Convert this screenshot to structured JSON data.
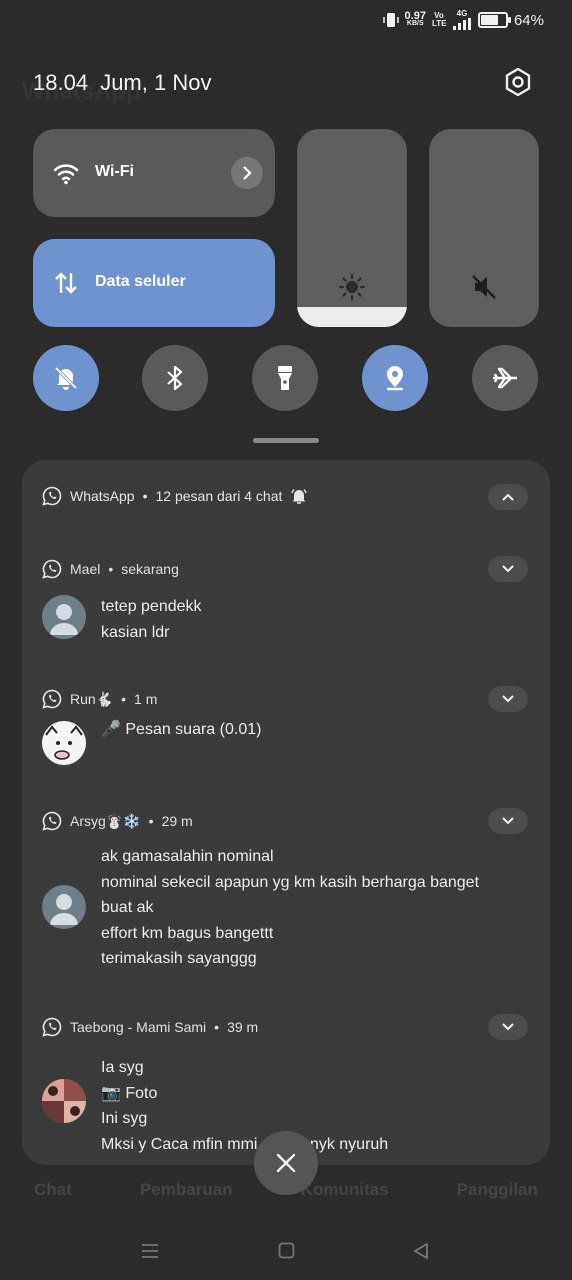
{
  "status_bar": {
    "speed": "0.97",
    "speed_unit": "KB/S",
    "volte": "Vo LTE",
    "network": "4G",
    "battery_percent": "64%",
    "battery_level": 0.64
  },
  "header": {
    "time": "18.04",
    "date": "Jum, 1 Nov",
    "background_title": "WhatsApp"
  },
  "quick_settings": {
    "wifi_label": "Wi-Fi",
    "data_label": "Data seluler",
    "brightness_level": 0.1,
    "toggles": [
      {
        "name": "dnd",
        "icon": "bell-off-icon",
        "on": true
      },
      {
        "name": "bluetooth",
        "icon": "bluetooth-icon",
        "on": false
      },
      {
        "name": "flashlight",
        "icon": "flashlight-icon",
        "on": false
      },
      {
        "name": "location",
        "icon": "location-icon",
        "on": true
      },
      {
        "name": "airplane",
        "icon": "airplane-icon",
        "on": false
      }
    ]
  },
  "notifications": {
    "group": {
      "app": "WhatsApp",
      "summary": "12 pesan dari 4 chat"
    },
    "items": [
      {
        "sender": "Mael",
        "time": "sekarang",
        "messages": [
          "tetep pendekk",
          "kasian ldr"
        ]
      },
      {
        "sender": "Run🐇",
        "time": "1 m",
        "messages": [
          "🎤 Pesan suara (0.01)"
        ]
      },
      {
        "sender": "Arsyg☃️❄️",
        "time": "29 m",
        "messages": [
          "ak gamasalahin nominal",
          "nominal sekecil apapun yg km kasih berharga banget",
          "buat ak",
          "effort km bagus bangettt",
          "terimakasih sayanggg"
        ]
      },
      {
        "sender": "Taebong - Mami Sami",
        "time": "39 m",
        "messages": [
          "Ia syg",
          "📷 Foto",
          "Ini syg",
          "Mksi y Caca mfin mmi sring bnyk nyuruh"
        ]
      }
    ]
  },
  "background_tabs": [
    "Chat",
    "Pembaruan",
    "Komunitas",
    "Panggilan"
  ]
}
